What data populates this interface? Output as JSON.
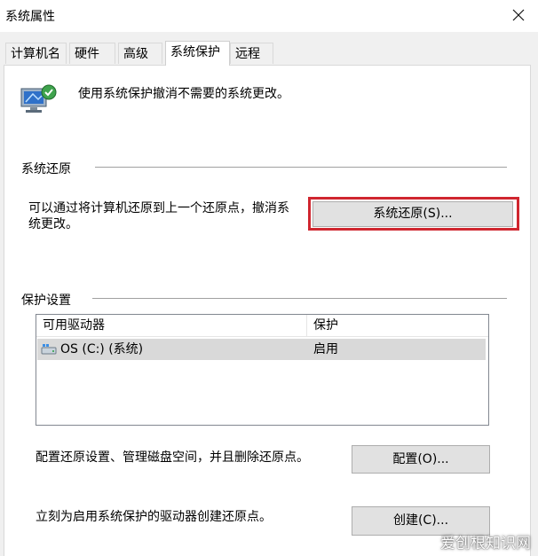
{
  "window": {
    "title": "系统属性"
  },
  "tabs": [
    {
      "label": "计算机名"
    },
    {
      "label": "硬件"
    },
    {
      "label": "高级"
    },
    {
      "label": "系统保护"
    },
    {
      "label": "远程"
    }
  ],
  "intro": {
    "text": "使用系统保护撤消不需要的系统更改。"
  },
  "restore": {
    "group_title": "系统还原",
    "description": "可以通过将计算机还原到上一个还原点，撤消系统更改。",
    "description_line1": "可以通过将计算机还原到上一个还原点，撤消系",
    "description_line2": "统更改。",
    "button": "系统还原(S)..."
  },
  "protection": {
    "group_title": "保护设置",
    "columns": [
      "可用驱动器",
      "保护"
    ],
    "drives": [
      {
        "name": "OS (C:) (系统)",
        "status": "启用"
      }
    ],
    "configure_text": "配置还原设置、管理磁盘空间，并且删除还原点。",
    "configure_button": "配置(O)...",
    "create_text": "立刻为启用系统保护的驱动器创建还原点。",
    "create_button": "创建(C)..."
  },
  "watermark": "爱创根知识网",
  "colors": {
    "highlight": "#d0262f",
    "selected_row": "#d9d9d9",
    "button_bg": "#e1e1e1"
  }
}
